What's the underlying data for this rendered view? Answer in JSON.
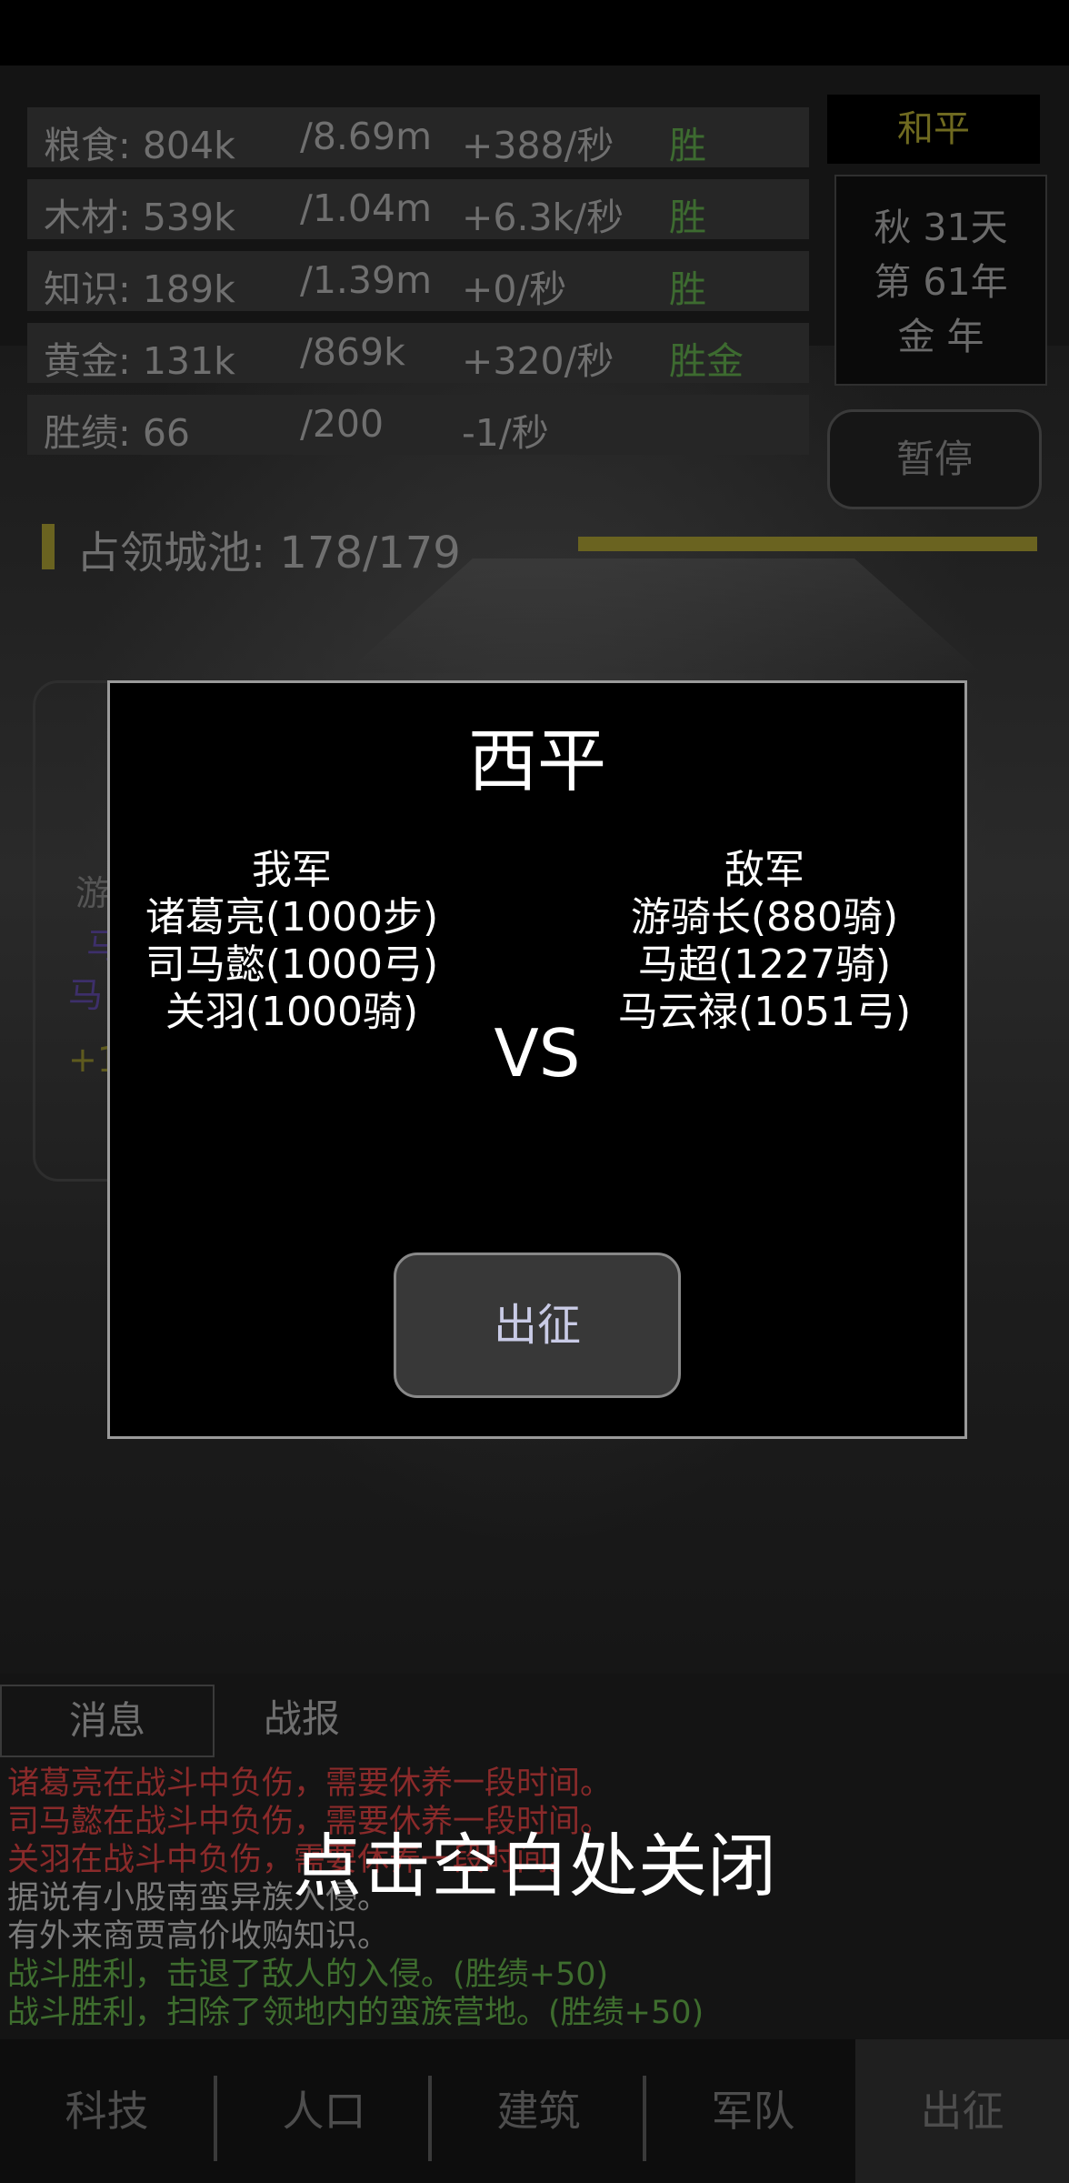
{
  "resources": [
    {
      "name": "粮食: 804k",
      "cap": "/8.69m",
      "rate": "+388/秒",
      "flag": "胜"
    },
    {
      "name": "木材: 539k",
      "cap": "/1.04m",
      "rate": "+6.3k/秒",
      "flag": "胜"
    },
    {
      "name": "知识: 189k",
      "cap": "/1.39m",
      "rate": "+0/秒",
      "flag": "胜"
    },
    {
      "name": "黄金: 131k",
      "cap": "/869k",
      "rate": "+320/秒",
      "flag": "胜金"
    },
    {
      "name": "胜绩: 66",
      "cap": "/200",
      "rate": "-1/秒",
      "flag": ""
    }
  ],
  "state": "和平",
  "calendar": {
    "line1": "秋 31天",
    "line2": "第 61年",
    "line3": "金 年"
  },
  "pause_label": "暂停",
  "cities": {
    "label": "占领城池: 178/179",
    "progress": 0.994
  },
  "background_card": {
    "line1": "游",
    "line2": "马",
    "line3": "马",
    "line4": "+1"
  },
  "dialog": {
    "title": "西平",
    "ally": {
      "header": "我军",
      "units": [
        "诸葛亮(1000步)",
        "司马懿(1000弓)",
        "关羽(1000骑)"
      ]
    },
    "enemy": {
      "header": "敌军",
      "units": [
        "游骑长(880骑)",
        "马超(1227骑)",
        "马云禄(1051弓)"
      ]
    },
    "vs": "VS",
    "action_label": "出征"
  },
  "tabs": {
    "messages": "消息",
    "reports": "战报"
  },
  "logs": [
    {
      "text": "诸葛亮在战斗中负伤，需要休养一段时间。",
      "color": "#8a2a2a"
    },
    {
      "text": "司马懿在战斗中负伤，需要休养一段时间。",
      "color": "#8a2a2a"
    },
    {
      "text": "关羽在战斗中负伤，需要休养一段时间。",
      "color": "#8a2a2a"
    },
    {
      "text": "据说有小股南蛮异族入侵。",
      "color": "#7a7a7a"
    },
    {
      "text": "有外来商贾高价收购知识。",
      "color": "#7a7a7a"
    },
    {
      "text": "战斗胜利，击退了敌人的入侵。(胜绩+50)",
      "color": "#3e6d2e"
    },
    {
      "text": "战斗胜利，扫除了领地内的蛮族营地。(胜绩+50)",
      "color": "#3e6d2e"
    }
  ],
  "close_hint": "点击空白处关闭",
  "nav": [
    {
      "label": "科技",
      "active": false
    },
    {
      "label": "人口",
      "active": false
    },
    {
      "label": "建筑",
      "active": false
    },
    {
      "label": "军队",
      "active": false
    },
    {
      "label": "出征",
      "active": true
    }
  ]
}
